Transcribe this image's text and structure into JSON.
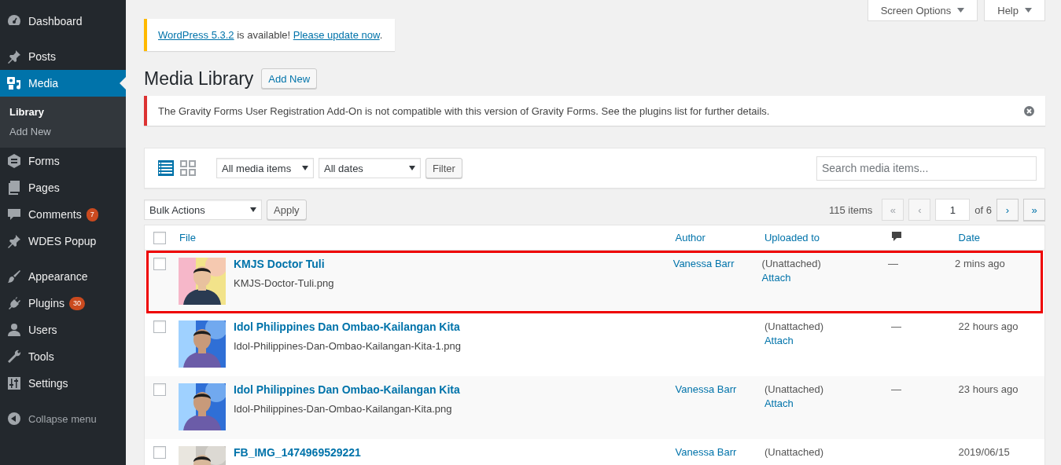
{
  "sidebar": {
    "groups": [
      [
        {
          "label": "Dashboard",
          "selected": false
        }
      ],
      [
        {
          "label": "Posts",
          "selected": false
        },
        {
          "label": "Media",
          "selected": true,
          "children": [
            {
              "label": "Library",
              "selected": true
            },
            {
              "label": "Add New",
              "selected": false
            }
          ]
        },
        {
          "label": "Forms",
          "selected": false
        },
        {
          "label": "Pages",
          "selected": false
        },
        {
          "label": "Comments",
          "selected": false,
          "badge": "7"
        },
        {
          "label": "WDES Popup",
          "selected": false
        }
      ],
      [
        {
          "label": "Appearance",
          "selected": false
        },
        {
          "label": "Plugins",
          "selected": false,
          "badge": "30"
        },
        {
          "label": "Users",
          "selected": false
        },
        {
          "label": "Tools",
          "selected": false
        },
        {
          "label": "Settings",
          "selected": false
        }
      ]
    ],
    "collapse": "Collapse menu"
  },
  "screen_meta": [
    "Screen Options",
    "Help"
  ],
  "update_notice": {
    "link": "WordPress 5.3.2",
    "text": " is available! ",
    "action": "Please update now",
    "end": "."
  },
  "page_title": "Media Library",
  "add_new": "Add New",
  "error_notice": {
    "text": "The Gravity Forms User Registration Add-On is not compatible with this version of Gravity Forms. See the plugins list for further details."
  },
  "toolbar": {
    "view_modes": [
      {
        "selected": true
      },
      {
        "selected": false
      }
    ],
    "filters": [
      "All media items",
      "All dates"
    ],
    "filter_button": "Filter",
    "search": {
      "placeholder": "Search media items..."
    }
  },
  "tablenav": {
    "bulk_actions": "Bulk Actions",
    "apply": "Apply",
    "count": "115 items",
    "pages": [
      {
        "label": "«",
        "disabled": true
      },
      {
        "label": "‹",
        "disabled": true
      }
    ],
    "current_page": "1",
    "total": "of 6",
    "next": [
      {
        "label": "›",
        "disabled": false
      },
      {
        "label": "»",
        "disabled": false
      }
    ]
  },
  "table": {
    "select_all": {
      "checked": false
    },
    "columns": [
      {
        "kind": "text",
        "label": "File"
      },
      {
        "kind": "text",
        "label": "Author"
      },
      {
        "kind": "text",
        "label": "Uploaded to"
      },
      {
        "kind": "icon"
      },
      {
        "kind": "text",
        "label": "Date"
      }
    ],
    "rows": [
      {
        "checked": false,
        "highlighted": true,
        "title": "KMJS Doctor Tuli",
        "filename": "KMJS-Doctor-Tuli.png",
        "author": "Vanessa Barr",
        "uploaded_to": "(Unattached)",
        "action": "Attach",
        "comments": "—",
        "date": "2 mins ago"
      },
      {
        "checked": false,
        "highlighted": false,
        "title": "Idol Philippines Dan Ombao-Kailangan Kita",
        "filename": "Idol-Philippines-Dan-Ombao-Kailangan-Kita-1.png",
        "uploaded_to": "(Unattached)",
        "action": "Attach",
        "comments": "—",
        "date": "22 hours ago"
      },
      {
        "checked": false,
        "highlighted": false,
        "title": "Idol Philippines Dan Ombao-Kailangan Kita",
        "filename": "Idol-Philippines-Dan-Ombao-Kailangan-Kita.png",
        "author": "Vanessa Barr",
        "uploaded_to": "(Unattached)",
        "action": "Attach",
        "comments": "—",
        "date": "23 hours ago"
      },
      {
        "checked": false,
        "highlighted": false,
        "title": "FB_IMG_1474969529221",
        "author": "Vanessa Barr",
        "uploaded_to": "(Unattached)",
        "date": "2019/06/15"
      }
    ]
  }
}
